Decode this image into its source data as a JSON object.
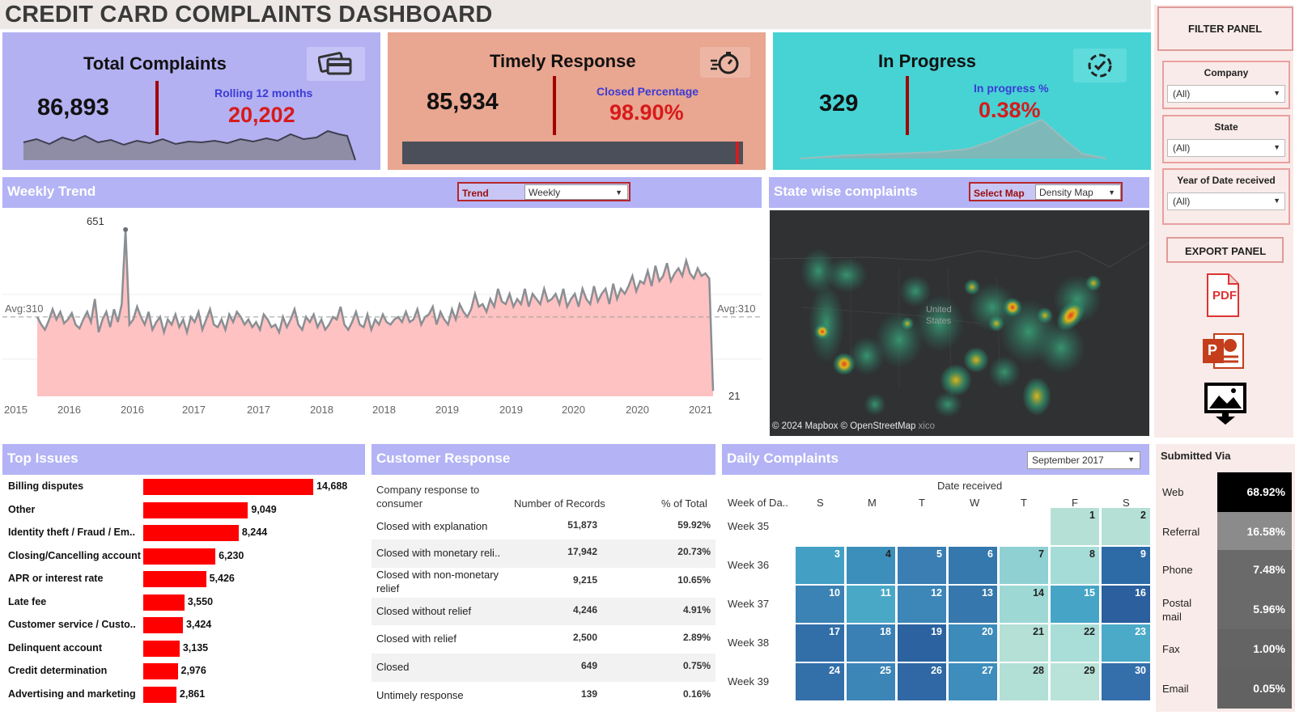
{
  "title": "CREDIT CARD COMPLAINTS DASHBOARD",
  "kpis": {
    "total": {
      "title": "Total Complaints",
      "value": "86,893",
      "sub_label": "Rolling 12 months",
      "sub_value": "20,202",
      "icon": "credit-card-icon"
    },
    "timely": {
      "title": "Timely Response",
      "value": "85,934",
      "sub_label": "Closed Percentage",
      "sub_value": "98.90%",
      "icon": "stopwatch-icon",
      "closed_fraction": 0.989
    },
    "inprogress": {
      "title": "In Progress",
      "value": "329",
      "sub_label": "In progress %",
      "sub_value": "0.38%",
      "icon": "circle-check-icon"
    }
  },
  "weekly_trend": {
    "header": "Weekly Trend",
    "trend_label": "Trend",
    "trend_value": "Weekly",
    "avg_left": "Avg:310",
    "avg_right": "Avg:310",
    "peak_label": "651",
    "end_label": "21"
  },
  "chart_data": {
    "type": "area",
    "title": "Weekly Trend",
    "x_ticks": [
      "2015",
      "2016",
      "2016",
      "2017",
      "2017",
      "2018",
      "2018",
      "2019",
      "2019",
      "2020",
      "2020",
      "2021"
    ],
    "average": 310,
    "peak": 651,
    "last": 21,
    "ylim": [
      0,
      720
    ],
    "grid": true,
    "series": [
      {
        "values": [
          310,
          282,
          260,
          295,
          340,
          300,
          330,
          285,
          300,
          325,
          280,
          265,
          300,
          330,
          290,
          380,
          250,
          300,
          330,
          270,
          340,
          290,
          360,
          651,
          280,
          300,
          350,
          310,
          280,
          330,
          260,
          290,
          310,
          250,
          300,
          280,
          320,
          270,
          300,
          250,
          310,
          290,
          330,
          260,
          300,
          340,
          280,
          270,
          300,
          260,
          320,
          290,
          330,
          310,
          280,
          300,
          270,
          290,
          260,
          320,
          300,
          270,
          280,
          250,
          310,
          270,
          300,
          340,
          280,
          260,
          310,
          290,
          320,
          270,
          300,
          260,
          280,
          310,
          300,
          350,
          280,
          260,
          290,
          330,
          280,
          270,
          320,
          260,
          300,
          280,
          320,
          290,
          280,
          300,
          310,
          290,
          330,
          290,
          300,
          340,
          280,
          310,
          320,
          350,
          280,
          330,
          300,
          280,
          340,
          300,
          360,
          330,
          310,
          340,
          400,
          350,
          360,
          330,
          380,
          350,
          420,
          370,
          360,
          400,
          350,
          380,
          360,
          420,
          350,
          400,
          380,
          360,
          420,
          370,
          380,
          400,
          360,
          420,
          350,
          380,
          400,
          350,
          420,
          380,
          360,
          430,
          370,
          400,
          420,
          360,
          440,
          380,
          420,
          400,
          430,
          470,
          410,
          450,
          440,
          490,
          430,
          510,
          450,
          470,
          520,
          450,
          480,
          500,
          470,
          530,
          480,
          460,
          500,
          470,
          480,
          460,
          21
        ]
      }
    ]
  },
  "state_map": {
    "header": "State wise complaints",
    "select_label": "Select Map",
    "select_value": "Density Map",
    "map_label": "United States",
    "mexico_label": "xico",
    "attribution": "© 2024 Mapbox © OpenStreetMap"
  },
  "filter_panel": {
    "title": "FILTER PANEL",
    "company_label": "Company",
    "company_value": "(All)",
    "state_label": "State",
    "state_value": "(All)",
    "year_label": "Year of Date received",
    "year_value": "(All)"
  },
  "export_panel": {
    "title": "EXPORT PANEL",
    "pdf_label": "PDF",
    "ppt_label": "P"
  },
  "top_issues": {
    "header": "Top Issues",
    "items": [
      {
        "label": "Billing disputes",
        "value": 14688,
        "display": "14,688"
      },
      {
        "label": "Other",
        "value": 9049,
        "display": "9,049"
      },
      {
        "label": "Identity theft / Fraud / Em..",
        "value": 8244,
        "display": "8,244"
      },
      {
        "label": "Closing/Cancelling account",
        "value": 6230,
        "display": "6,230"
      },
      {
        "label": "APR or interest rate",
        "value": 5426,
        "display": "5,426"
      },
      {
        "label": "Late fee",
        "value": 3550,
        "display": "3,550"
      },
      {
        "label": "Customer service / Custo..",
        "value": 3424,
        "display": "3,424"
      },
      {
        "label": "Delinquent account",
        "value": 3135,
        "display": "3,135"
      },
      {
        "label": "Credit determination",
        "value": 2976,
        "display": "2,976"
      },
      {
        "label": "Advertising and marketing",
        "value": 2861,
        "display": "2,861"
      }
    ]
  },
  "customer_response": {
    "header": "Customer Response",
    "col1": "Company response to consumer",
    "col2": "Number of Records",
    "col3": "% of Total",
    "rows": [
      {
        "label": "Closed with explanation",
        "count": "51,873",
        "pct": "59.92%"
      },
      {
        "label": "Closed with monetary reli..",
        "count": "17,942",
        "pct": "20.73%"
      },
      {
        "label": "Closed with non-monetary relief",
        "count": "9,215",
        "pct": "10.65%"
      },
      {
        "label": "Closed without relief",
        "count": "4,246",
        "pct": "4.91%"
      },
      {
        "label": "Closed with relief",
        "count": "2,500",
        "pct": "2.89%"
      },
      {
        "label": "Closed",
        "count": "649",
        "pct": "0.75%"
      },
      {
        "label": "Untimely response",
        "count": "139",
        "pct": "0.16%"
      }
    ]
  },
  "daily_complaints": {
    "header": "Daily Complaints",
    "month_value": "September 2017",
    "date_received_label": "Date received",
    "week_col_label": "Week of Da..",
    "days": [
      "S",
      "M",
      "T",
      "W",
      "T",
      "F",
      "S"
    ],
    "weeks": [
      "Week 35",
      "Week 36",
      "Week 37",
      "Week 38",
      "Week 39"
    ],
    "cells": [
      {
        "day": "1",
        "w": 0,
        "d": 5,
        "color": "#b5e0d6",
        "dark": true
      },
      {
        "day": "2",
        "w": 0,
        "d": 6,
        "color": "#b5e0d6",
        "dark": true
      },
      {
        "day": "3",
        "w": 1,
        "d": 0,
        "color": "#43a0c4",
        "dark": false
      },
      {
        "day": "4",
        "w": 1,
        "d": 1,
        "color": "#3d8fbb",
        "dark": true
      },
      {
        "day": "5",
        "w": 1,
        "d": 2,
        "color": "#3a7eb3",
        "dark": false
      },
      {
        "day": "6",
        "w": 1,
        "d": 3,
        "color": "#3578ad",
        "dark": false
      },
      {
        "day": "7",
        "w": 1,
        "d": 4,
        "color": "#8fd0d3",
        "dark": true
      },
      {
        "day": "8",
        "w": 1,
        "d": 5,
        "color": "#a5dcd8",
        "dark": true
      },
      {
        "day": "9",
        "w": 1,
        "d": 6,
        "color": "#2d6ba7",
        "dark": false
      },
      {
        "day": "10",
        "w": 2,
        "d": 0,
        "color": "#3b82b5",
        "dark": false
      },
      {
        "day": "11",
        "w": 2,
        "d": 1,
        "color": "#4aa8c7",
        "dark": false
      },
      {
        "day": "12",
        "w": 2,
        "d": 2,
        "color": "#3c86b8",
        "dark": false
      },
      {
        "day": "13",
        "w": 2,
        "d": 3,
        "color": "#3678ad",
        "dark": false
      },
      {
        "day": "14",
        "w": 2,
        "d": 4,
        "color": "#9ed8d5",
        "dark": true
      },
      {
        "day": "15",
        "w": 2,
        "d": 5,
        "color": "#46a5c7",
        "dark": false
      },
      {
        "day": "16",
        "w": 2,
        "d": 6,
        "color": "#2b5f9e",
        "dark": false
      },
      {
        "day": "17",
        "w": 3,
        "d": 0,
        "color": "#326fa9",
        "dark": false
      },
      {
        "day": "18",
        "w": 3,
        "d": 1,
        "color": "#3a80b4",
        "dark": false
      },
      {
        "day": "19",
        "w": 3,
        "d": 2,
        "color": "#2c629f",
        "dark": false
      },
      {
        "day": "20",
        "w": 3,
        "d": 3,
        "color": "#3c8bba",
        "dark": false
      },
      {
        "day": "21",
        "w": 3,
        "d": 4,
        "color": "#b4e0d6",
        "dark": true
      },
      {
        "day": "22",
        "w": 3,
        "d": 5,
        "color": "#a9ddd7",
        "dark": true
      },
      {
        "day": "23",
        "w": 3,
        "d": 6,
        "color": "#4aaac8",
        "dark": false
      },
      {
        "day": "24",
        "w": 4,
        "d": 0,
        "color": "#336fa9",
        "dark": false
      },
      {
        "day": "25",
        "w": 4,
        "d": 1,
        "color": "#3c85b7",
        "dark": false
      },
      {
        "day": "26",
        "w": 4,
        "d": 2,
        "color": "#2f68a4",
        "dark": false
      },
      {
        "day": "27",
        "w": 4,
        "d": 3,
        "color": "#3e8dbc",
        "dark": false
      },
      {
        "day": "28",
        "w": 4,
        "d": 4,
        "color": "#b2dfd6",
        "dark": true
      },
      {
        "day": "29",
        "w": 4,
        "d": 5,
        "color": "#b9e2d8",
        "dark": true
      },
      {
        "day": "30",
        "w": 4,
        "d": 6,
        "color": "#346fab",
        "dark": false
      }
    ]
  },
  "submitted_via": {
    "header": "Submitted Via",
    "items": [
      {
        "label": "Web",
        "pct": "68.92%",
        "color": "#000000"
      },
      {
        "label": "Referral",
        "pct": "16.58%",
        "color": "#8b8b8b"
      },
      {
        "label": "Phone",
        "pct": "7.48%",
        "color": "#6a6a6a"
      },
      {
        "label": "Postal mail",
        "pct": "5.96%",
        "color": "#6a6a6a"
      },
      {
        "label": "Fax",
        "pct": "1.00%",
        "color": "#646464"
      },
      {
        "label": "Email",
        "pct": "0.05%",
        "color": "#626262"
      }
    ]
  }
}
